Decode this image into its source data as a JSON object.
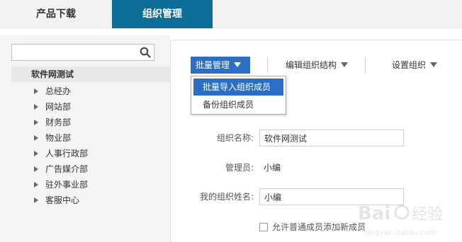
{
  "tabs": [
    {
      "label": "产品下载"
    },
    {
      "label": "组织管理"
    }
  ],
  "sidebar": {
    "search": {
      "value": "",
      "placeholder": ""
    },
    "root_label": "软件网测试",
    "items": [
      {
        "label": "总经办"
      },
      {
        "label": "网站部"
      },
      {
        "label": "财务部"
      },
      {
        "label": "物业部"
      },
      {
        "label": "人事行政部"
      },
      {
        "label": "广告媒介部"
      },
      {
        "label": "驻外事业部"
      },
      {
        "label": "客服中心"
      }
    ]
  },
  "toolbar": {
    "batch_label": "批量管理",
    "edit_structure_label": "编辑组织结构",
    "settings_label": "设置组织"
  },
  "dropdown": {
    "items": [
      {
        "label": "批量导入组织成员"
      },
      {
        "label": "备份组织成员"
      }
    ]
  },
  "form": {
    "org_name_label": "组织名称:",
    "org_name_value": "软件网测试",
    "admin_label": "管理员:",
    "admin_value": "小编",
    "my_name_label": "我的组织姓名:",
    "my_name_value": "小编",
    "allow_add_label": "允许普通成员添加新成员",
    "allow_add_checked": false
  },
  "colors": {
    "active_tab": "#0c6e96",
    "accent_blue": "#2a6fc4",
    "panel_gray": "#f4f4f4"
  }
}
